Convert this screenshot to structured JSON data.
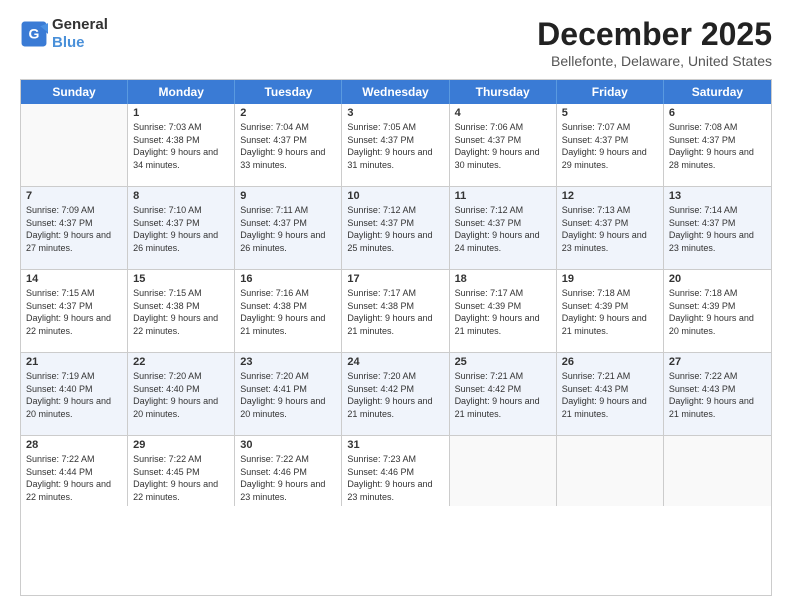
{
  "header": {
    "logo_general": "General",
    "logo_blue": "Blue",
    "title": "December 2025",
    "subtitle": "Bellefonte, Delaware, United States"
  },
  "calendar": {
    "days": [
      "Sunday",
      "Monday",
      "Tuesday",
      "Wednesday",
      "Thursday",
      "Friday",
      "Saturday"
    ],
    "rows": [
      [
        {
          "day": "",
          "sunrise": "",
          "sunset": "",
          "daylight": "",
          "empty": true
        },
        {
          "day": "1",
          "sunrise": "Sunrise: 7:03 AM",
          "sunset": "Sunset: 4:38 PM",
          "daylight": "Daylight: 9 hours and 34 minutes."
        },
        {
          "day": "2",
          "sunrise": "Sunrise: 7:04 AM",
          "sunset": "Sunset: 4:37 PM",
          "daylight": "Daylight: 9 hours and 33 minutes."
        },
        {
          "day": "3",
          "sunrise": "Sunrise: 7:05 AM",
          "sunset": "Sunset: 4:37 PM",
          "daylight": "Daylight: 9 hours and 31 minutes."
        },
        {
          "day": "4",
          "sunrise": "Sunrise: 7:06 AM",
          "sunset": "Sunset: 4:37 PM",
          "daylight": "Daylight: 9 hours and 30 minutes."
        },
        {
          "day": "5",
          "sunrise": "Sunrise: 7:07 AM",
          "sunset": "Sunset: 4:37 PM",
          "daylight": "Daylight: 9 hours and 29 minutes."
        },
        {
          "day": "6",
          "sunrise": "Sunrise: 7:08 AM",
          "sunset": "Sunset: 4:37 PM",
          "daylight": "Daylight: 9 hours and 28 minutes."
        }
      ],
      [
        {
          "day": "7",
          "sunrise": "Sunrise: 7:09 AM",
          "sunset": "Sunset: 4:37 PM",
          "daylight": "Daylight: 9 hours and 27 minutes."
        },
        {
          "day": "8",
          "sunrise": "Sunrise: 7:10 AM",
          "sunset": "Sunset: 4:37 PM",
          "daylight": "Daylight: 9 hours and 26 minutes."
        },
        {
          "day": "9",
          "sunrise": "Sunrise: 7:11 AM",
          "sunset": "Sunset: 4:37 PM",
          "daylight": "Daylight: 9 hours and 26 minutes."
        },
        {
          "day": "10",
          "sunrise": "Sunrise: 7:12 AM",
          "sunset": "Sunset: 4:37 PM",
          "daylight": "Daylight: 9 hours and 25 minutes."
        },
        {
          "day": "11",
          "sunrise": "Sunrise: 7:12 AM",
          "sunset": "Sunset: 4:37 PM",
          "daylight": "Daylight: 9 hours and 24 minutes."
        },
        {
          "day": "12",
          "sunrise": "Sunrise: 7:13 AM",
          "sunset": "Sunset: 4:37 PM",
          "daylight": "Daylight: 9 hours and 23 minutes."
        },
        {
          "day": "13",
          "sunrise": "Sunrise: 7:14 AM",
          "sunset": "Sunset: 4:37 PM",
          "daylight": "Daylight: 9 hours and 23 minutes."
        }
      ],
      [
        {
          "day": "14",
          "sunrise": "Sunrise: 7:15 AM",
          "sunset": "Sunset: 4:37 PM",
          "daylight": "Daylight: 9 hours and 22 minutes."
        },
        {
          "day": "15",
          "sunrise": "Sunrise: 7:15 AM",
          "sunset": "Sunset: 4:38 PM",
          "daylight": "Daylight: 9 hours and 22 minutes."
        },
        {
          "day": "16",
          "sunrise": "Sunrise: 7:16 AM",
          "sunset": "Sunset: 4:38 PM",
          "daylight": "Daylight: 9 hours and 21 minutes."
        },
        {
          "day": "17",
          "sunrise": "Sunrise: 7:17 AM",
          "sunset": "Sunset: 4:38 PM",
          "daylight": "Daylight: 9 hours and 21 minutes."
        },
        {
          "day": "18",
          "sunrise": "Sunrise: 7:17 AM",
          "sunset": "Sunset: 4:39 PM",
          "daylight": "Daylight: 9 hours and 21 minutes."
        },
        {
          "day": "19",
          "sunrise": "Sunrise: 7:18 AM",
          "sunset": "Sunset: 4:39 PM",
          "daylight": "Daylight: 9 hours and 21 minutes."
        },
        {
          "day": "20",
          "sunrise": "Sunrise: 7:18 AM",
          "sunset": "Sunset: 4:39 PM",
          "daylight": "Daylight: 9 hours and 20 minutes."
        }
      ],
      [
        {
          "day": "21",
          "sunrise": "Sunrise: 7:19 AM",
          "sunset": "Sunset: 4:40 PM",
          "daylight": "Daylight: 9 hours and 20 minutes."
        },
        {
          "day": "22",
          "sunrise": "Sunrise: 7:20 AM",
          "sunset": "Sunset: 4:40 PM",
          "daylight": "Daylight: 9 hours and 20 minutes."
        },
        {
          "day": "23",
          "sunrise": "Sunrise: 7:20 AM",
          "sunset": "Sunset: 4:41 PM",
          "daylight": "Daylight: 9 hours and 20 minutes."
        },
        {
          "day": "24",
          "sunrise": "Sunrise: 7:20 AM",
          "sunset": "Sunset: 4:42 PM",
          "daylight": "Daylight: 9 hours and 21 minutes."
        },
        {
          "day": "25",
          "sunrise": "Sunrise: 7:21 AM",
          "sunset": "Sunset: 4:42 PM",
          "daylight": "Daylight: 9 hours and 21 minutes."
        },
        {
          "day": "26",
          "sunrise": "Sunrise: 7:21 AM",
          "sunset": "Sunset: 4:43 PM",
          "daylight": "Daylight: 9 hours and 21 minutes."
        },
        {
          "day": "27",
          "sunrise": "Sunrise: 7:22 AM",
          "sunset": "Sunset: 4:43 PM",
          "daylight": "Daylight: 9 hours and 21 minutes."
        }
      ],
      [
        {
          "day": "28",
          "sunrise": "Sunrise: 7:22 AM",
          "sunset": "Sunset: 4:44 PM",
          "daylight": "Daylight: 9 hours and 22 minutes."
        },
        {
          "day": "29",
          "sunrise": "Sunrise: 7:22 AM",
          "sunset": "Sunset: 4:45 PM",
          "daylight": "Daylight: 9 hours and 22 minutes."
        },
        {
          "day": "30",
          "sunrise": "Sunrise: 7:22 AM",
          "sunset": "Sunset: 4:46 PM",
          "daylight": "Daylight: 9 hours and 23 minutes."
        },
        {
          "day": "31",
          "sunrise": "Sunrise: 7:23 AM",
          "sunset": "Sunset: 4:46 PM",
          "daylight": "Daylight: 9 hours and 23 minutes."
        },
        {
          "day": "",
          "sunrise": "",
          "sunset": "",
          "daylight": "",
          "empty": true
        },
        {
          "day": "",
          "sunrise": "",
          "sunset": "",
          "daylight": "",
          "empty": true
        },
        {
          "day": "",
          "sunrise": "",
          "sunset": "",
          "daylight": "",
          "empty": true
        }
      ]
    ]
  }
}
